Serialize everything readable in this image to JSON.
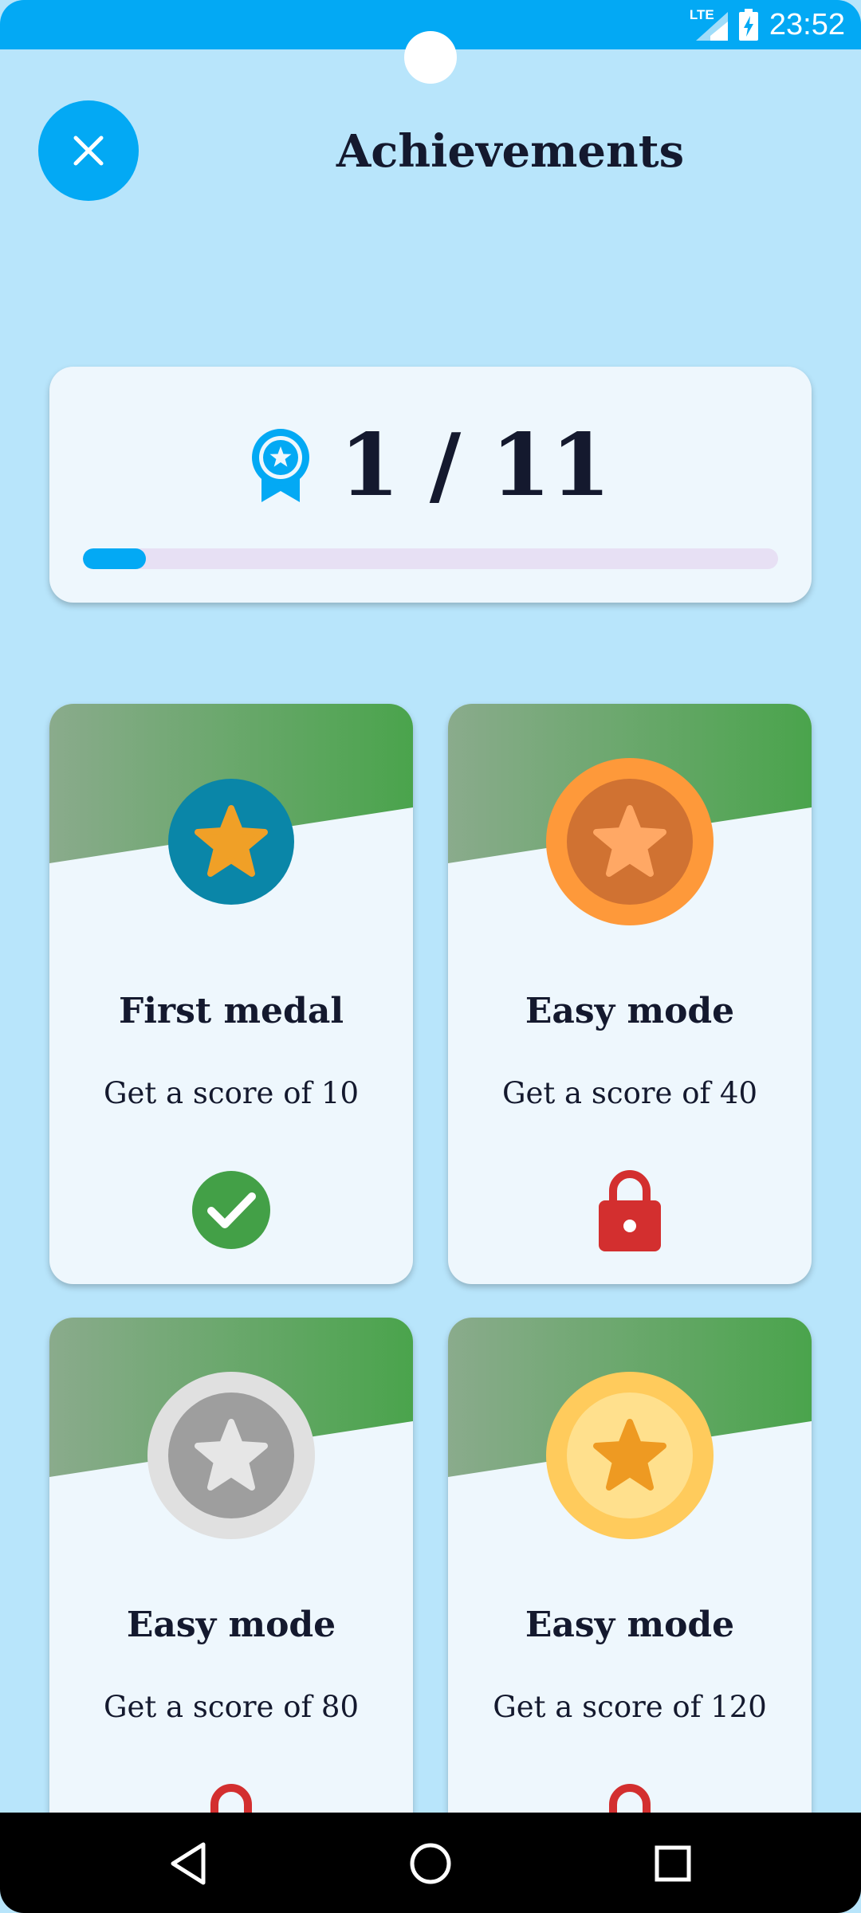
{
  "status_bar": {
    "network": "LTE",
    "time": "23:52"
  },
  "header": {
    "title": "Achievements"
  },
  "progress": {
    "text": "1 / 11",
    "unlocked": 1,
    "total": 11
  },
  "achievements": [
    {
      "title": "First medal",
      "description": "Get a score of 10",
      "status": "unlocked",
      "medal": "teal"
    },
    {
      "title": "Easy mode",
      "description": "Get a score of 40",
      "status": "locked",
      "medal": "bronze"
    },
    {
      "title": "Easy mode",
      "description": "Get a score of 80",
      "status": "locked",
      "medal": "silver"
    },
    {
      "title": "Easy mode",
      "description": "Get a score of 120",
      "status": "locked",
      "medal": "gold"
    }
  ],
  "icons": {
    "close": "close-icon",
    "progress": "award-ribbon-icon",
    "unlocked": "check-circle-icon",
    "locked": "lock-icon",
    "medal": "star-medal-icon"
  },
  "colors": {
    "accent": "#03a9f4",
    "background": "#b8e5fb",
    "card": "#eef7fd",
    "success": "#43a047",
    "locked": "#d32f2f",
    "progress_track": "#e7e0f4"
  }
}
